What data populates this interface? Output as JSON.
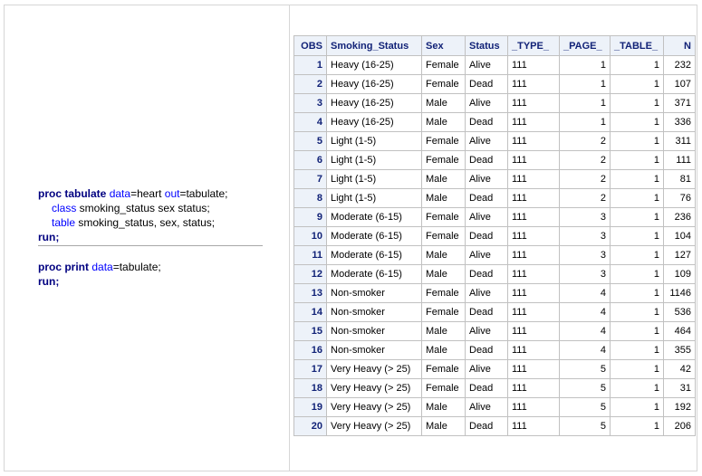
{
  "code": {
    "block1": {
      "line1": {
        "kw": "proc tabulate",
        "opt1": "data",
        "val1": "=heart ",
        "opt2": "out",
        "val2": "=tabulate;"
      },
      "line2": {
        "kw": "class",
        "rest": " smoking_status sex status;"
      },
      "line3": {
        "kw": "table",
        "rest": " smoking_status, sex, status;"
      },
      "line4": {
        "kw": "run;"
      }
    },
    "block2": {
      "line1": {
        "kw": "proc print",
        "opt1": "data",
        "val1": "=tabulate;"
      },
      "line2": {
        "kw": "run;"
      }
    }
  },
  "table": {
    "headers": [
      "OBS",
      "Smoking_Status",
      "Sex",
      "Status",
      "_TYPE_",
      "_PAGE_",
      "_TABLE_",
      "N"
    ],
    "rows": [
      [
        "1",
        "Heavy (16-25)",
        "Female",
        "Alive",
        "111",
        "1",
        "1",
        "232"
      ],
      [
        "2",
        "Heavy (16-25)",
        "Female",
        "Dead",
        "111",
        "1",
        "1",
        "107"
      ],
      [
        "3",
        "Heavy (16-25)",
        "Male",
        "Alive",
        "111",
        "1",
        "1",
        "371"
      ],
      [
        "4",
        "Heavy (16-25)",
        "Male",
        "Dead",
        "111",
        "1",
        "1",
        "336"
      ],
      [
        "5",
        "Light (1-5)",
        "Female",
        "Alive",
        "111",
        "2",
        "1",
        "311"
      ],
      [
        "6",
        "Light (1-5)",
        "Female",
        "Dead",
        "111",
        "2",
        "1",
        "111"
      ],
      [
        "7",
        "Light (1-5)",
        "Male",
        "Alive",
        "111",
        "2",
        "1",
        "81"
      ],
      [
        "8",
        "Light (1-5)",
        "Male",
        "Dead",
        "111",
        "2",
        "1",
        "76"
      ],
      [
        "9",
        "Moderate (6-15)",
        "Female",
        "Alive",
        "111",
        "3",
        "1",
        "236"
      ],
      [
        "10",
        "Moderate (6-15)",
        "Female",
        "Dead",
        "111",
        "3",
        "1",
        "104"
      ],
      [
        "11",
        "Moderate (6-15)",
        "Male",
        "Alive",
        "111",
        "3",
        "1",
        "127"
      ],
      [
        "12",
        "Moderate (6-15)",
        "Male",
        "Dead",
        "111",
        "3",
        "1",
        "109"
      ],
      [
        "13",
        "Non-smoker",
        "Female",
        "Alive",
        "111",
        "4",
        "1",
        "1146"
      ],
      [
        "14",
        "Non-smoker",
        "Female",
        "Dead",
        "111",
        "4",
        "1",
        "536"
      ],
      [
        "15",
        "Non-smoker",
        "Male",
        "Alive",
        "111",
        "4",
        "1",
        "464"
      ],
      [
        "16",
        "Non-smoker",
        "Male",
        "Dead",
        "111",
        "4",
        "1",
        "355"
      ],
      [
        "17",
        "Very Heavy (> 25)",
        "Female",
        "Alive",
        "111",
        "5",
        "1",
        "42"
      ],
      [
        "18",
        "Very Heavy (> 25)",
        "Female",
        "Dead",
        "111",
        "5",
        "1",
        "31"
      ],
      [
        "19",
        "Very Heavy (> 25)",
        "Male",
        "Alive",
        "111",
        "5",
        "1",
        "192"
      ],
      [
        "20",
        "Very Heavy (> 25)",
        "Male",
        "Dead",
        "111",
        "5",
        "1",
        "206"
      ]
    ]
  },
  "colors": {
    "header_bg": "#edf2f9",
    "header_text": "#112277",
    "keyword": "#000080",
    "option": "#0000ff",
    "border": "#c1c1c1"
  }
}
